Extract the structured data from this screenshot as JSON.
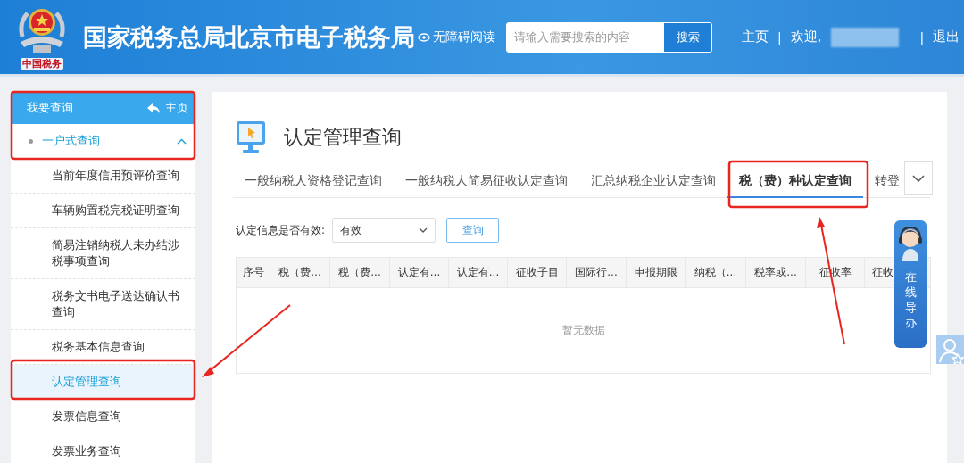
{
  "header": {
    "logo_caption": "中国税务",
    "title": "国家税务总局北京市电子税务局",
    "accessibility_link": "无障碍阅读",
    "search": {
      "placeholder": "请输入需要搜索的内容",
      "button": "搜索"
    },
    "home_link": "主页",
    "separators": [
      "|",
      "|"
    ],
    "welcome": "欢迎,",
    "logout": "退出"
  },
  "sidebar": {
    "title": "我要查询",
    "home_link": "主页",
    "group": {
      "label": "一户式查询",
      "expanded": true,
      "items": [
        {
          "label": "当前年度信用预评价查询",
          "selected": false
        },
        {
          "label": "车辆购置税完税证明查询",
          "selected": false
        },
        {
          "label": "简易注销纳税人未办结涉税事项查询",
          "selected": false
        },
        {
          "label": "税务文书电子送达确认书查询",
          "selected": false
        },
        {
          "label": "税务基本信息查询",
          "selected": false
        },
        {
          "label": "认定管理查询",
          "selected": true
        },
        {
          "label": "发票信息查询",
          "selected": false
        },
        {
          "label": "发票业务查询",
          "selected": false
        }
      ]
    }
  },
  "main": {
    "title": "认定管理查询",
    "tabs": [
      {
        "label": "一般纳税人资格登记查询",
        "selected": false
      },
      {
        "label": "一般纳税人简易征收认定查询",
        "selected": false
      },
      {
        "label": "汇总纳税企业认定查询",
        "selected": false
      },
      {
        "label": "税（费）种认定查询",
        "selected": true
      },
      {
        "label": "转登",
        "selected": false
      }
    ],
    "filter": {
      "label": "认定信息是否有效:",
      "value": "有效",
      "button": "查询"
    },
    "table": {
      "columns": [
        "序号",
        "税（费...",
        "税（费...",
        "认定有...",
        "认定有...",
        "征收子目",
        "国际行...",
        "申报期限",
        "纳税（...",
        "税率或...",
        "征收率",
        "征收"
      ],
      "empty_text": "暂无数据"
    }
  },
  "help_widget": {
    "label": "在线导办"
  }
}
